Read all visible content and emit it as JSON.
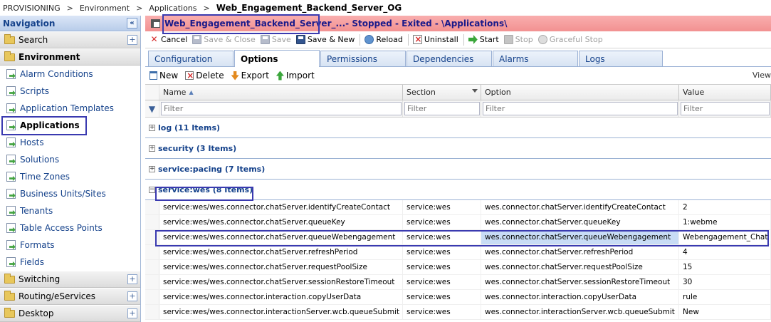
{
  "breadcrumb": {
    "items": [
      "PROVISIONING",
      "Environment",
      "Applications"
    ],
    "separator": ">",
    "current": "Web_Engagement_Backend_Server_OG"
  },
  "navigation": {
    "title": "Navigation",
    "collapse_glyph": "«",
    "expand_glyph": "+",
    "search_label": "Search",
    "environment_label": "Environment",
    "items": [
      {
        "label": "Alarm Conditions"
      },
      {
        "label": "Scripts"
      },
      {
        "label": "Application Templates"
      },
      {
        "label": "Applications"
      },
      {
        "label": "Hosts"
      },
      {
        "label": "Solutions"
      },
      {
        "label": "Time Zones"
      },
      {
        "label": "Business Units/Sites"
      },
      {
        "label": "Tenants"
      },
      {
        "label": "Table Access Points"
      },
      {
        "label": "Formats"
      },
      {
        "label": "Fields"
      }
    ],
    "bottom_sections": [
      {
        "label": "Switching"
      },
      {
        "label": "Routing/eServices"
      },
      {
        "label": "Desktop"
      }
    ]
  },
  "title_bar": {
    "app_name": "Web_Engagement_Backend_Server_...",
    "status": " - Stopped - Exited - \\Applications\\"
  },
  "toolbar": {
    "cancel": "Cancel",
    "save_close": "Save & Close",
    "save": "Save",
    "save_new": "Save & New",
    "reload": "Reload",
    "uninstall": "Uninstall",
    "start": "Start",
    "stop": "Stop",
    "graceful_stop": "Graceful Stop"
  },
  "tabs": [
    {
      "label": "Configuration"
    },
    {
      "label": "Options"
    },
    {
      "label": "Permissions"
    },
    {
      "label": "Dependencies"
    },
    {
      "label": "Alarms"
    },
    {
      "label": "Logs"
    }
  ],
  "active_tab": "Options",
  "options_toolbar": {
    "new": "New",
    "delete": "Delete",
    "export": "Export",
    "import": "Import",
    "view": "View"
  },
  "grid": {
    "columns": [
      "Name",
      "Section",
      "Option",
      "Value"
    ],
    "sort_indicator": "▲",
    "filter_placeholder": "Filter",
    "groups": [
      {
        "label": "log (11 Items)",
        "expanded": false
      },
      {
        "label": "security (3 Items)",
        "expanded": false
      },
      {
        "label": "service:pacing (7 Items)",
        "expanded": false
      },
      {
        "label": "service:wes (8 Items)",
        "expanded": true
      }
    ],
    "rows": [
      {
        "name": "service:wes/wes.connector.chatServer.identifyCreateContact",
        "section": "service:wes",
        "option": "wes.connector.chatServer.identifyCreateContact",
        "value": "2"
      },
      {
        "name": "service:wes/wes.connector.chatServer.queueKey",
        "section": "service:wes",
        "option": "wes.connector.chatServer.queueKey",
        "value": "1:webme"
      },
      {
        "name": "service:wes/wes.connector.chatServer.queueWebengagement",
        "section": "service:wes",
        "option": "wes.connector.chatServer.queueWebengagement",
        "value": "Webengagement_Chat"
      },
      {
        "name": "service:wes/wes.connector.chatServer.refreshPeriod",
        "section": "service:wes",
        "option": "wes.connector.chatServer.refreshPeriod",
        "value": "4"
      },
      {
        "name": "service:wes/wes.connector.chatServer.requestPoolSize",
        "section": "service:wes",
        "option": "wes.connector.chatServer.requestPoolSize",
        "value": "15"
      },
      {
        "name": "service:wes/wes.connector.chatServer.sessionRestoreTimeout",
        "section": "service:wes",
        "option": "wes.connector.chatServer.sessionRestoreTimeout",
        "value": "30"
      },
      {
        "name": "service:wes/wes.connector.interaction.copyUserData",
        "section": "service:wes",
        "option": "wes.connector.interaction.copyUserData",
        "value": "rule"
      },
      {
        "name": "service:wes/wes.connector.interactionServer.wcb.queueSubmit",
        "section": "service:wes",
        "option": "wes.connector.interactionServer.wcb.queueSubmit",
        "value": "New"
      }
    ]
  },
  "colors": {
    "title_bar_bg": "#f29191",
    "highlight_box": "#3a3ab0",
    "link_blue": "#15428b",
    "selected_option_bg": "#c8dcf5"
  }
}
